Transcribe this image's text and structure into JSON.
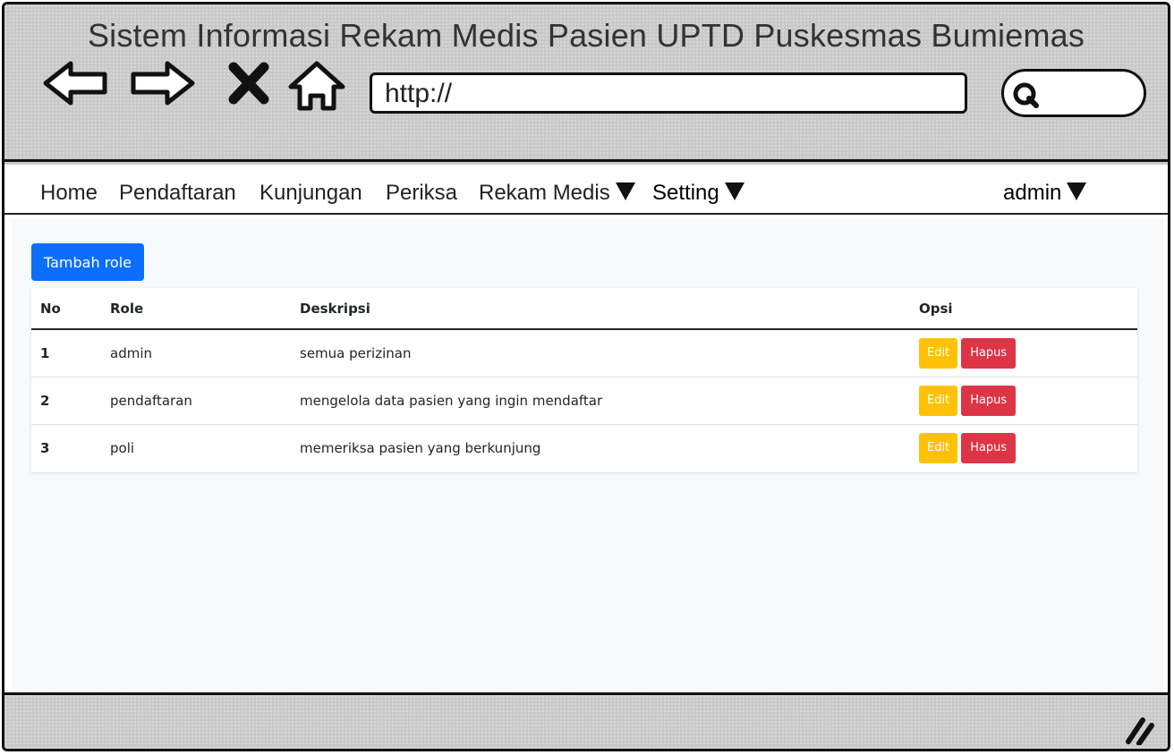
{
  "window": {
    "title": "Sistem Informasi Rekam Medis Pasien UPTD Puskesmas Bumiemas",
    "url": "http://"
  },
  "menu": {
    "items": [
      {
        "label": "Home"
      },
      {
        "label": "Pendaftaran"
      },
      {
        "label": "Kunjungan"
      },
      {
        "label": "Periksa"
      },
      {
        "label": "Rekam Medis",
        "dropdown": true
      },
      {
        "label": "Setting",
        "dropdown": true
      }
    ],
    "user": "admin"
  },
  "actions": {
    "add_label": "Tambah role"
  },
  "table": {
    "headers": [
      "No",
      "Role",
      "Deskripsi",
      "Opsi"
    ],
    "rows": [
      {
        "no": "1",
        "role": "admin",
        "desc": "semua perizinan"
      },
      {
        "no": "2",
        "role": "pendaftaran",
        "desc": "mengelola data pasien yang ingin mendaftar"
      },
      {
        "no": "3",
        "role": "poli",
        "desc": "memeriksa pasien yang berkunjung"
      }
    ],
    "edit_label": "Edit",
    "delete_label": "Hapus"
  },
  "colors": {
    "primary": "#0d6efd",
    "warning": "#ffc107",
    "danger": "#dc3545"
  },
  "icons": [
    "back-arrow-icon",
    "forward-arrow-icon",
    "close-icon",
    "home-icon",
    "search-icon",
    "resize-grip-icon",
    "caret-down-icon"
  ]
}
